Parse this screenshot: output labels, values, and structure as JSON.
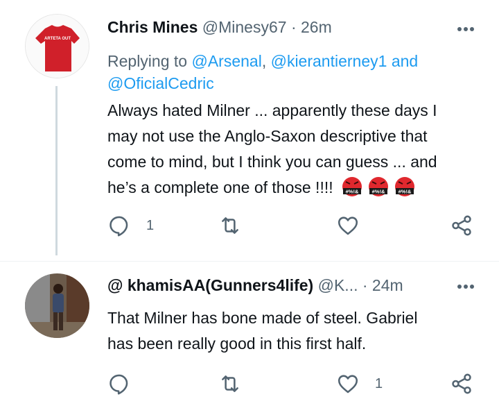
{
  "tweet1": {
    "name": "Chris Mines",
    "handle": "@Minesy67",
    "dot": "·",
    "time": "26m",
    "avatar_text": "ARTETA OUT",
    "replying_prefix": "Replying to",
    "mentions": [
      "@Arsenal",
      "@kierantierney1",
      "@OficialCedric"
    ],
    "and_word": "and",
    "comma": ",",
    "text_lines": [
      "Always hated Milner ... apparently these days I",
      "may not use the Anglo-Saxon descriptive that",
      "come to mind, but I think you can guess ... and",
      "he’s a complete one of those !!!!"
    ],
    "emoji_label": "#%!&",
    "emoji_count": 3,
    "reply_count": "1",
    "retweet_count": "",
    "like_count": ""
  },
  "tweet2": {
    "name": "@ khamisAA(Gunners4life)",
    "handle": "@K...",
    "dot": "·",
    "time": "24m",
    "text_lines": [
      "That Milner has bone made of steel. Gabriel",
      "has been really good in this first half."
    ],
    "reply_count": "",
    "retweet_count": "",
    "like_count": "1"
  },
  "icons": {
    "reply": "reply-icon",
    "retweet": "retweet-icon",
    "like": "heart-icon",
    "share": "share-icon",
    "more": "more-icon"
  },
  "colors": {
    "text": "#0f1419",
    "secondary": "#536471",
    "link": "#1d9bf0",
    "thread_line": "#cfd9de",
    "shirt_red": "#d0202a",
    "emoji_red": "#e0282e"
  }
}
